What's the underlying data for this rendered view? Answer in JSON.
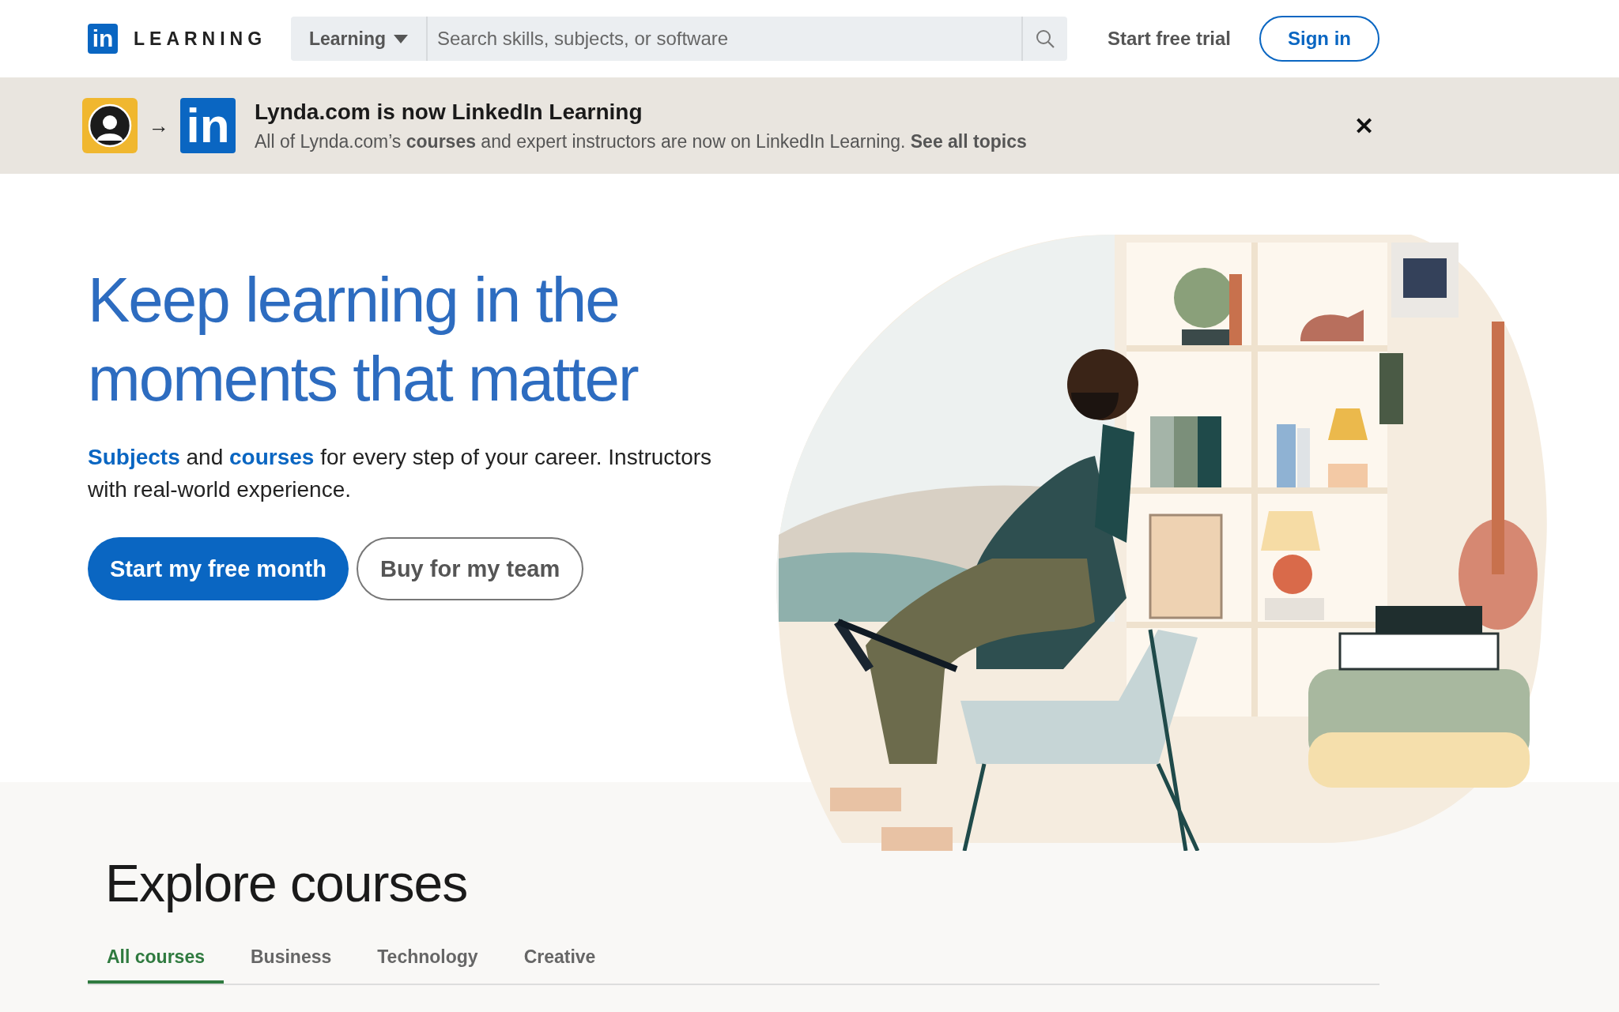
{
  "header": {
    "logo_mark": "in",
    "logo_text": "LEARNING",
    "search": {
      "scope": "Learning",
      "placeholder": "Search skills, subjects, or software"
    },
    "links": [
      "Start free trial"
    ],
    "sign_in": "Sign in"
  },
  "banner": {
    "logo_mark": "in",
    "arrow": "→",
    "title": "Lynda.com is now LinkedIn Learning",
    "text": "All of Lynda.com’s **courses** and expert instructors are now on LinkedIn Learning.",
    "link": "See all topics",
    "close": "✕"
  },
  "hero": {
    "heading": "Keep learning in the moments that matter",
    "intro": [
      {
        "text": "Subjects",
        "link": true
      },
      {
        "text": " and ",
        "link": false
      },
      {
        "text": "courses",
        "link": true
      },
      {
        "text": " for every step of your career. Instructors with real-world experience.",
        "link": false
      }
    ],
    "buttons": [
      {
        "label": "Start my free month",
        "kind": "primary"
      },
      {
        "label": "Buy for my team",
        "kind": "secondary"
      }
    ]
  },
  "explore": {
    "title": "Explore courses",
    "tabs": [
      {
        "label": "All courses",
        "selected": true
      },
      {
        "label": "Business",
        "selected": false
      },
      {
        "label": "Technology",
        "selected": false
      },
      {
        "label": "Creative",
        "selected": false
      }
    ]
  }
}
